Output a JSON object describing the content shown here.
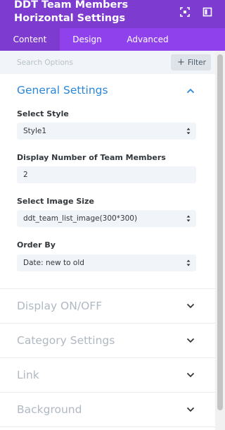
{
  "header": {
    "title": "DDT Team Members Horizontal Settings"
  },
  "tabs": [
    {
      "label": "Content",
      "active": true
    },
    {
      "label": "Design",
      "active": false
    },
    {
      "label": "Advanced",
      "active": false
    }
  ],
  "search": {
    "placeholder": "Search Options",
    "filter_label": "Filter"
  },
  "general_settings": {
    "title": "General Settings",
    "expanded": true,
    "fields": {
      "select_style": {
        "label": "Select Style",
        "value": "Style1"
      },
      "display_number": {
        "label": "Display Number of Team Members",
        "value": "2"
      },
      "image_size": {
        "label": "Select Image Size",
        "value": "ddt_team_list_image(300*300)"
      },
      "order_by": {
        "label": "Order By",
        "value": "Date: new to old"
      }
    }
  },
  "collapsed_sections": [
    {
      "title": "Display ON/OFF"
    },
    {
      "title": "Category Settings"
    },
    {
      "title": "Link"
    },
    {
      "title": "Background"
    }
  ],
  "colors": {
    "header_bg": "#7e3bd0",
    "tab_bar_bg": "#8f42ec",
    "section_accent": "#2b87da",
    "collapsed_text": "#b0b8c2"
  },
  "icons": {
    "expand": "expand-icon",
    "layout": "layout-icon",
    "filter": "plus-icon",
    "chevron_up": "chevron-up-icon",
    "chevron_down": "chevron-down-icon",
    "select": "select-arrows-icon"
  }
}
